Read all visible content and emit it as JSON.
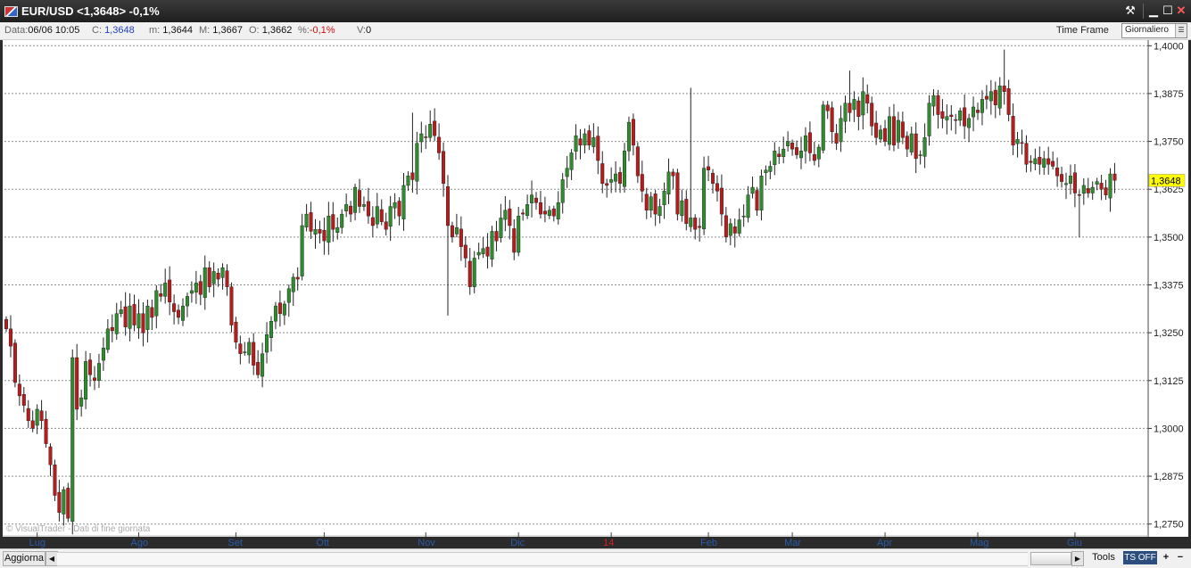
{
  "window": {
    "title": "EUR/USD <1,3648> -0,1%"
  },
  "info": {
    "data_label": "Data:",
    "data_value": "06/06 10:05",
    "c_label": "C:",
    "c_value": "1,3648",
    "m_label": "m:",
    "m_value": "1,3644",
    "M_label": "M:",
    "M_value": "1,3667",
    "o_label": "O:",
    "o_value": "1,3662",
    "pct_label": "%:",
    "pct_value": "-0,1%",
    "v_label": "V:",
    "v_value": "0"
  },
  "timeframe": {
    "label": "Time Frame",
    "selected": "Giornaliero"
  },
  "footer": {
    "aggiorna": "Aggiorna",
    "tools": "Tools",
    "ts": "TS OFF",
    "plus": "+",
    "minus": "−"
  },
  "colors": {
    "up": "#2e8b2e",
    "down": "#b71c1c",
    "grid": "#8a8a8a",
    "last_price_bg": "#ffff00",
    "month_label": "#2a5aa8",
    "year_label": "#d62020",
    "wick": "#222222"
  },
  "chart_data": {
    "type": "candlestick",
    "ylim": [
      1.274,
      1.401
    ],
    "yticks": [
      "1,4000",
      "1,3875",
      "1,3750",
      "1,3625",
      "1,3500",
      "1,3375",
      "1,3250",
      "1,3125",
      "1,3000",
      "1,2875",
      "1,2750"
    ],
    "ytick_values": [
      1.4,
      1.3875,
      1.375,
      1.3625,
      1.35,
      1.3375,
      1.325,
      1.3125,
      1.3,
      1.2875,
      1.275
    ],
    "last_price": 1.3648,
    "last_price_label": "1,3648",
    "watermark": "© VisualTrader - Dati di fine giornata",
    "xlabels": [
      {
        "text": "Lug",
        "index": 7,
        "year": false
      },
      {
        "text": "Ago",
        "index": 30,
        "year": false
      },
      {
        "text": "Set",
        "index": 52,
        "year": false
      },
      {
        "text": "Ott",
        "index": 72,
        "year": false
      },
      {
        "text": "Nov",
        "index": 95,
        "year": false
      },
      {
        "text": "Dic",
        "index": 116,
        "year": false
      },
      {
        "text": "14",
        "index": 137,
        "year": true
      },
      {
        "text": "Feb",
        "index": 159,
        "year": false
      },
      {
        "text": "Mar",
        "index": 178,
        "year": false
      },
      {
        "text": "Apr",
        "index": 199,
        "year": false
      },
      {
        "text": "Mag",
        "index": 220,
        "year": false
      },
      {
        "text": "Giu",
        "index": 242,
        "year": false
      }
    ],
    "closes": [
      1.326,
      1.3215,
      1.312,
      1.3085,
      1.306,
      1.302,
      1.3,
      1.305,
      1.302,
      1.296,
      1.2905,
      1.2825,
      1.278,
      1.284,
      1.2765,
      1.3185,
      1.305,
      1.308,
      1.3175,
      1.314,
      1.3125,
      1.317,
      1.321,
      1.326,
      1.3255,
      1.33,
      1.331,
      1.3265,
      1.332,
      1.327,
      1.33,
      1.325,
      1.332,
      1.329,
      1.336,
      1.3345,
      1.338,
      1.333,
      1.3305,
      1.329,
      1.332,
      1.3345,
      1.336,
      1.338,
      1.335,
      1.342,
      1.337,
      1.341,
      1.339,
      1.342,
      1.337,
      1.327,
      1.3225,
      1.3195,
      1.32,
      1.3225,
      1.3165,
      1.314,
      1.3195,
      1.3245,
      1.328,
      1.332,
      1.33,
      1.3325,
      1.3365,
      1.3395,
      1.339,
      1.353,
      1.356,
      1.3515,
      1.352,
      1.351,
      1.349,
      1.3555,
      1.352,
      1.3525,
      1.356,
      1.3585,
      1.356,
      1.363,
      1.358,
      1.3585,
      1.3555,
      1.353,
      1.358,
      1.354,
      1.352,
      1.358,
      1.359,
      1.3555,
      1.3635,
      1.366,
      1.365,
      1.3745,
      1.377,
      1.376,
      1.3795,
      1.3765,
      1.372,
      1.364,
      1.353,
      1.35,
      1.3525,
      1.3475,
      1.3445,
      1.337,
      1.3445,
      1.346,
      1.347,
      1.345,
      1.3515,
      1.349,
      1.355,
      1.357,
      1.353,
      1.346,
      1.3555,
      1.356,
      1.3585,
      1.361,
      1.359,
      1.356,
      1.356,
      1.357,
      1.3555,
      1.359,
      1.365,
      1.368,
      1.372,
      1.3765,
      1.374,
      1.377,
      1.374,
      1.376,
      1.37,
      1.364,
      1.3635,
      1.365,
      1.3665,
      1.364,
      1.3725,
      1.38,
      1.374,
      1.366,
      1.362,
      1.357,
      1.3605,
      1.356,
      1.358,
      1.362,
      1.367,
      1.366,
      1.356,
      1.3595,
      1.3535,
      1.355,
      1.352,
      1.3525,
      1.368,
      1.3675,
      1.364,
      1.362,
      1.356,
      1.35,
      1.3535,
      1.351,
      1.3545,
      1.3555,
      1.361,
      1.363,
      1.357,
      1.366,
      1.3675,
      1.3685,
      1.3725,
      1.371,
      1.373,
      1.375,
      1.373,
      1.3715,
      1.3725,
      1.3765,
      1.372,
      1.37,
      1.3735,
      1.3845,
      1.383,
      1.3775,
      1.3745,
      1.381,
      1.385,
      1.3825,
      1.386,
      1.3815,
      1.388,
      1.385,
      1.379,
      1.376,
      1.378,
      1.375,
      1.3815,
      1.374,
      1.3805,
      1.376,
      1.373,
      1.377,
      1.3705,
      1.3715,
      1.376,
      1.385,
      1.387,
      1.382,
      1.381,
      1.3815,
      1.3815,
      1.3805,
      1.383,
      1.379,
      1.381,
      1.384,
      1.3825,
      1.386,
      1.386,
      1.388,
      1.3845,
      1.3895,
      1.388,
      1.382,
      1.374,
      1.3755,
      1.3745,
      1.369,
      1.3695,
      1.3705,
      1.369,
      1.3705,
      1.369,
      1.3685,
      1.366,
      1.3645,
      1.364,
      1.366,
      1.3615,
      1.361,
      1.3635,
      1.3615,
      1.363,
      1.3645,
      1.3625,
      1.361,
      1.3665,
      1.3648
    ],
    "highs_extra": {
      "155": 1.389,
      "226": 1.399,
      "191": 1.3935,
      "92": 1.3825
    },
    "lows_extra": {
      "243": 1.35,
      "100": 1.3295,
      "14": 1.2755
    }
  }
}
